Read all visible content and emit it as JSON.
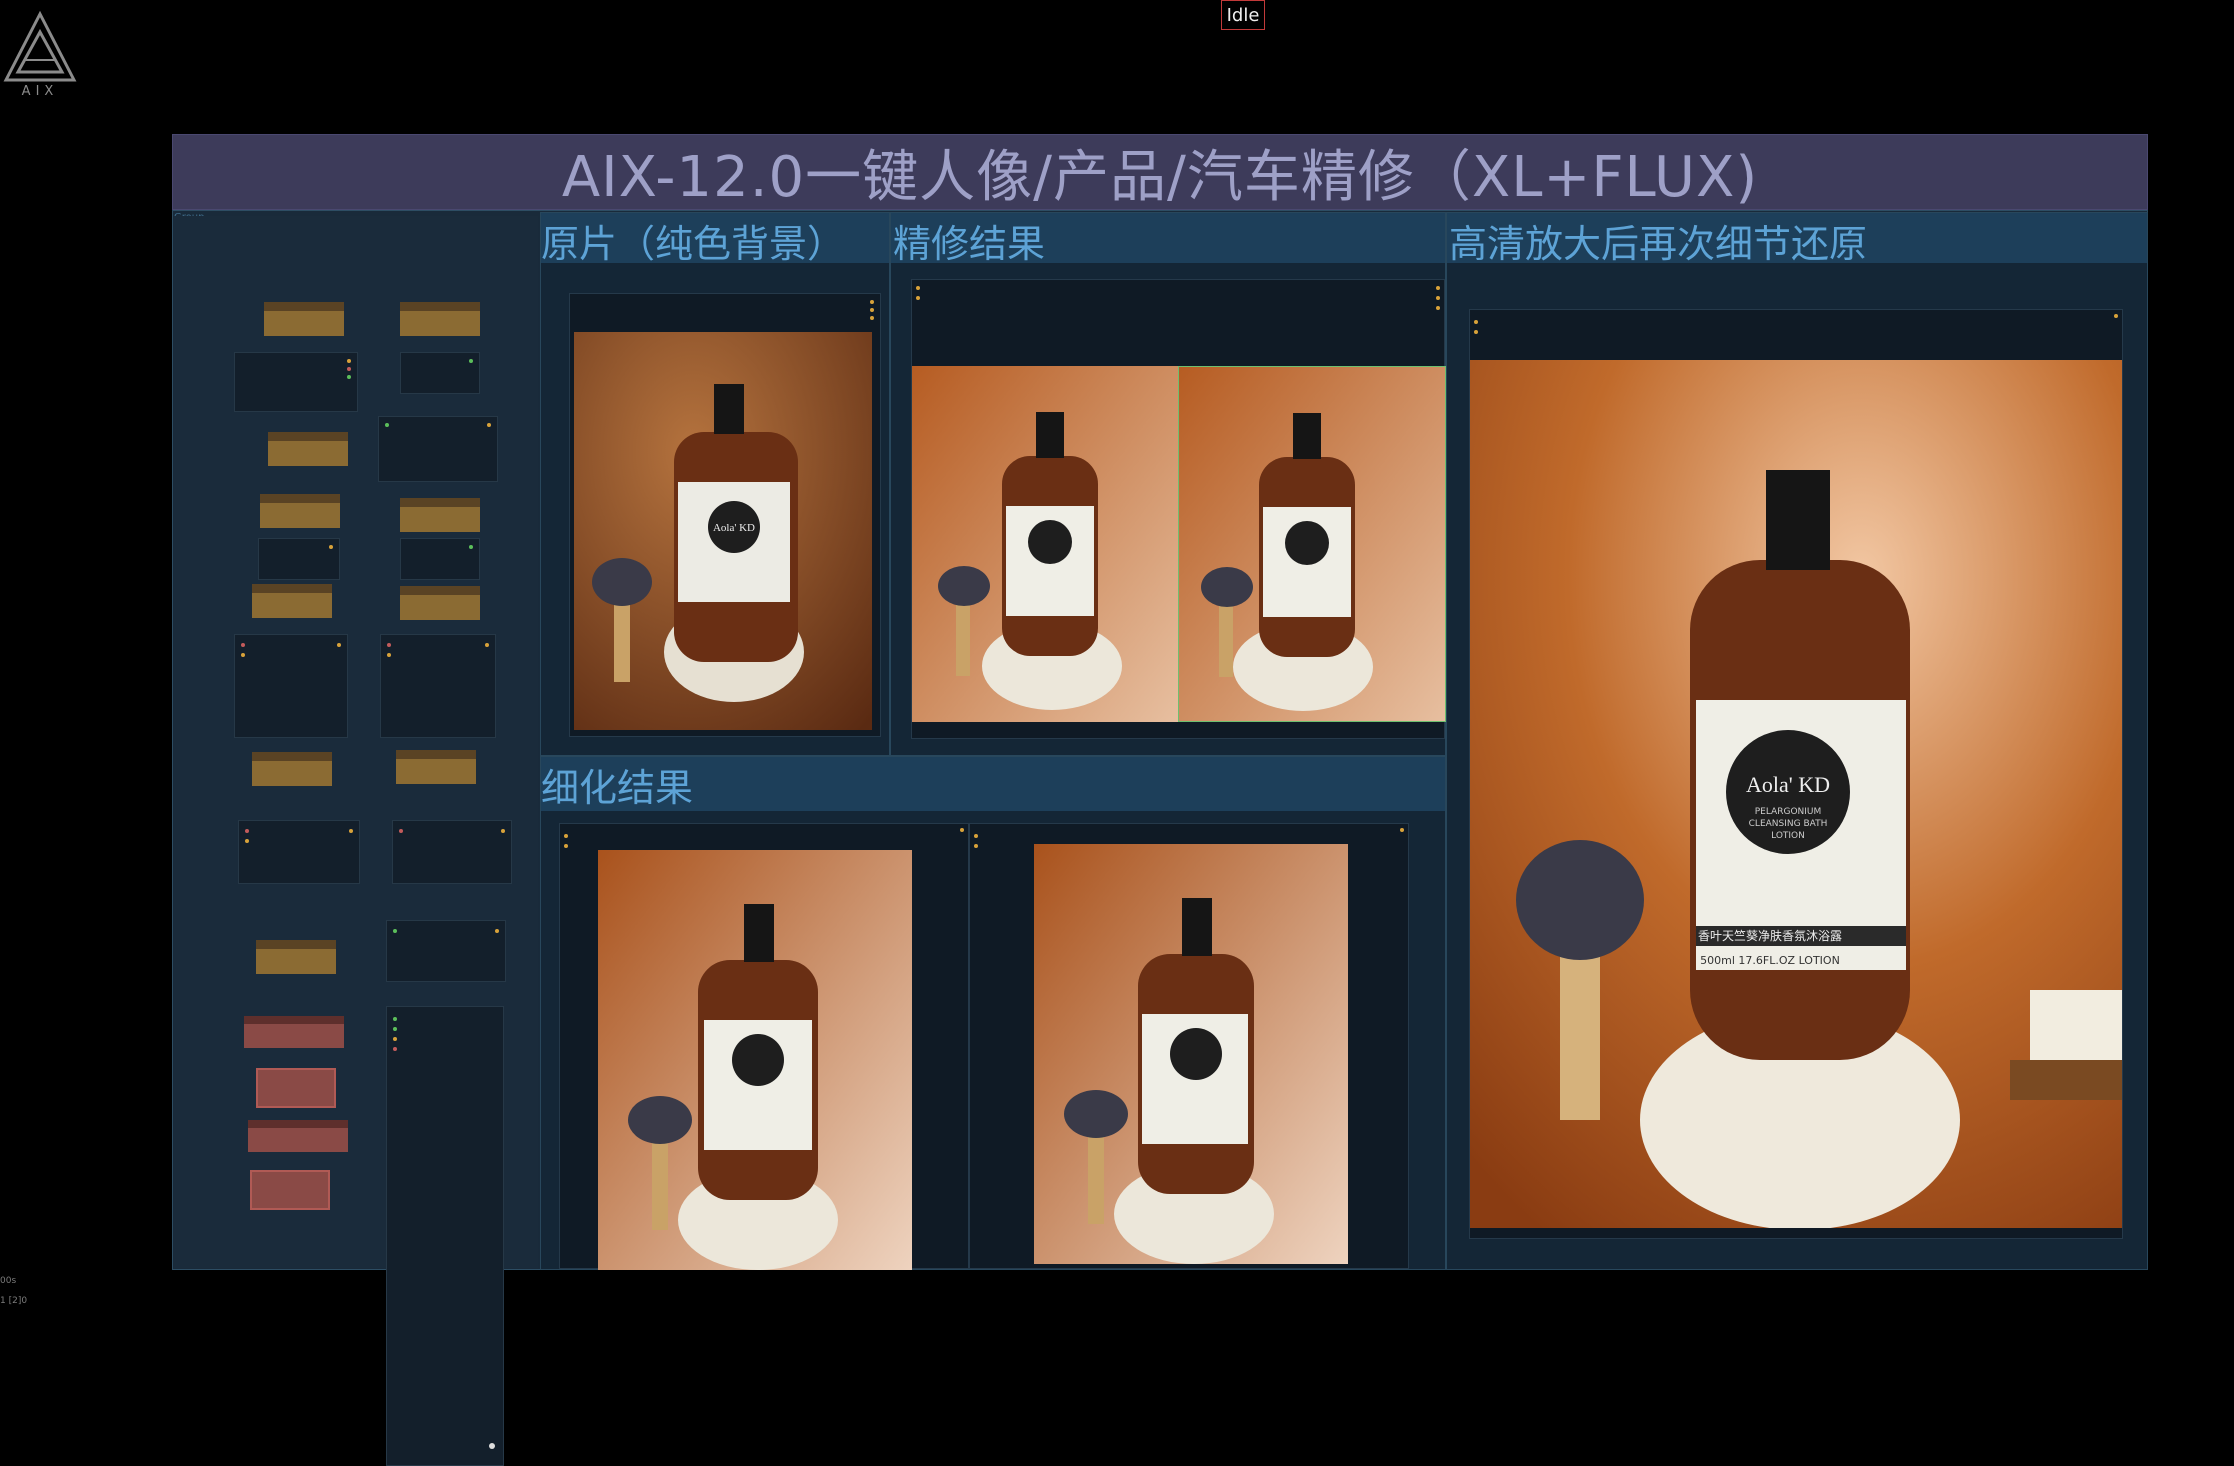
{
  "app": {
    "logo_text": "AIX",
    "status": "Idle"
  },
  "workflow": {
    "title": "AIX-12.0一键人像/产品/汽车精修（XL+FLUX)",
    "group_label": "Group",
    "sections": {
      "original": "原片（纯色背景）",
      "retouch": "精修结果",
      "upscale": "高清放大后再次细节还原",
      "refine": "细化结果"
    }
  },
  "product": {
    "brand": "Aola' KD",
    "line1": "PELARGONIUM",
    "line2": "CLEANSING BATH",
    "line3": "LOTION",
    "cn_name": "香叶天竺葵净肤香氛沐浴露",
    "volume": "500ml 17.6FL.OZ  LOTION"
  },
  "footer": {
    "line1": "00s",
    "line2": "1 [2]0"
  },
  "colors": {
    "background": "#000000",
    "title_bar": "#3d3b5a",
    "group": "#192a3a",
    "section_title": "#5da3d6",
    "status_border": "#c23a3a"
  }
}
